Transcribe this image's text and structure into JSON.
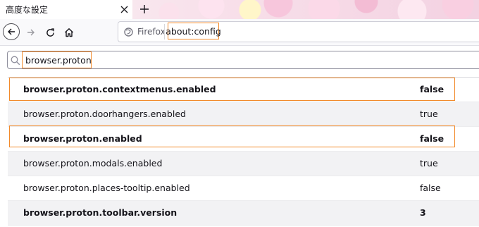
{
  "tab": {
    "title": "高度な設定",
    "close_icon": "close-icon"
  },
  "toolbar": {
    "back_icon": "back-arrow-icon",
    "forward_icon": "forward-arrow-icon",
    "reload_icon": "reload-icon",
    "home_icon": "home-icon"
  },
  "urlbar": {
    "identity_label": "Firefox",
    "url": "about:config"
  },
  "search": {
    "value": "browser.proton"
  },
  "prefs": [
    {
      "name": "browser.proton.contextmenus.enabled",
      "value": "false",
      "modified": true
    },
    {
      "name": "browser.proton.doorhangers.enabled",
      "value": "true",
      "modified": false
    },
    {
      "name": "browser.proton.enabled",
      "value": "false",
      "modified": true
    },
    {
      "name": "browser.proton.modals.enabled",
      "value": "true",
      "modified": false
    },
    {
      "name": "browser.proton.places-tooltip.enabled",
      "value": "false",
      "modified": false
    },
    {
      "name": "browser.proton.toolbar.version",
      "value": "3",
      "modified": true
    }
  ],
  "colors": {
    "highlight": "#f28a2a",
    "alt_row": "#f2f2f4"
  }
}
